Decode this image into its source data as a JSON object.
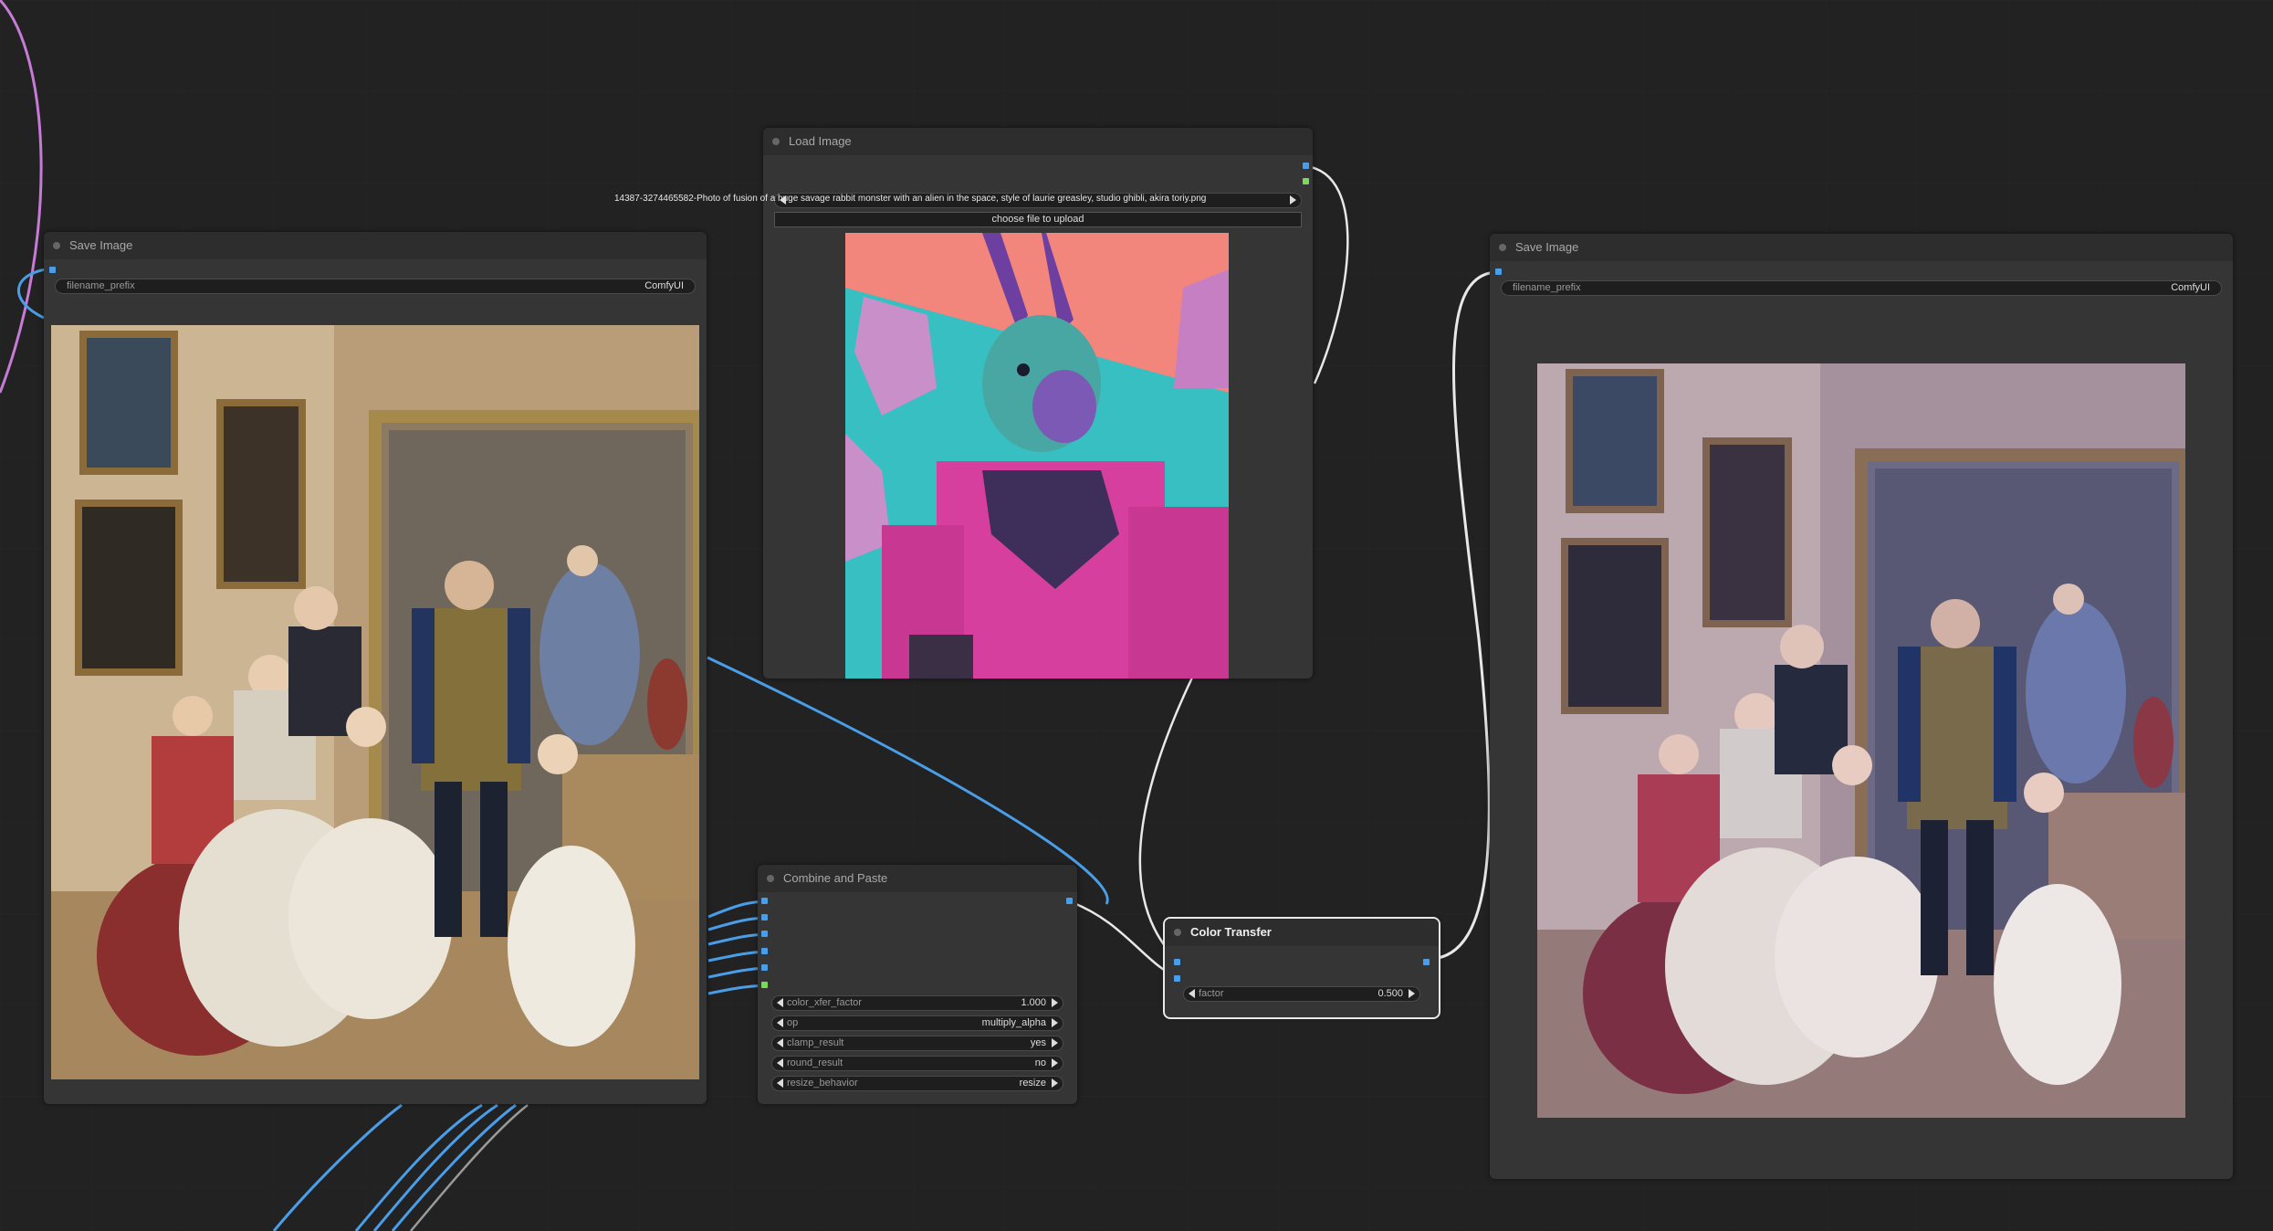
{
  "nodes": {
    "save_image_left": {
      "title": "Save Image",
      "widget_label": "filename_prefix",
      "widget_value": "ComfyUI"
    },
    "load_image": {
      "title": "Load Image",
      "filename": "14387-3274465582-Photo of fusion of a huge savage rabbit monster with an alien in the space, style of laurie greasley, studio ghibli, akira toriy.png",
      "upload_label": "choose file to upload"
    },
    "combine_and_paste": {
      "title": "Combine and Paste",
      "widgets": [
        {
          "label": "color_xfer_factor",
          "value": "1.000"
        },
        {
          "label": "op",
          "value": "multiply_alpha"
        },
        {
          "label": "clamp_result",
          "value": "yes"
        },
        {
          "label": "round_result",
          "value": "no"
        },
        {
          "label": "resize_behavior",
          "value": "resize"
        }
      ]
    },
    "color_transfer": {
      "title": "Color Transfer",
      "widget_label": "factor",
      "widget_value": "0.500"
    },
    "save_image_right": {
      "title": "Save Image",
      "widget_label": "filename_prefix",
      "widget_value": "ComfyUI"
    }
  },
  "colors": {
    "background": "#222222",
    "node_body": "#353535",
    "node_title": "#2d2d2d",
    "link_image": "#4a9ee8",
    "link_mask": "#e8e8e8",
    "link_latent": "#c77ad6",
    "slot_mask": "#7cd85a"
  }
}
